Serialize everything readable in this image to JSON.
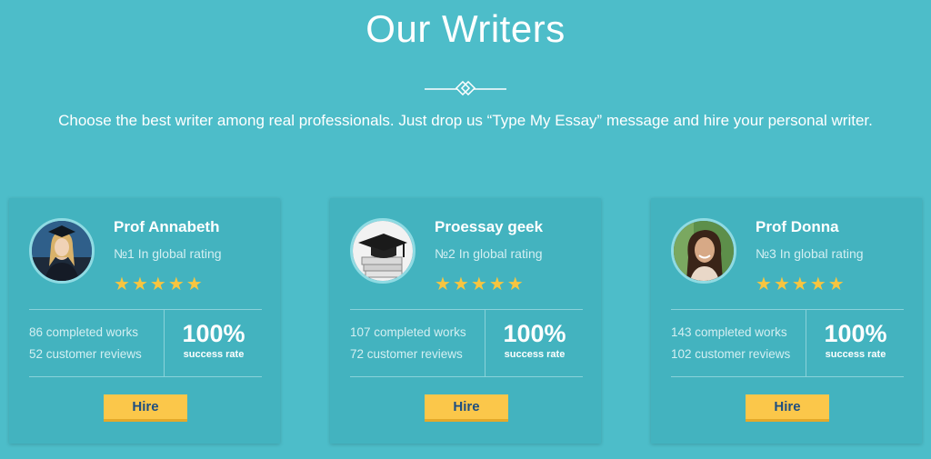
{
  "section": {
    "title": "Our Writers",
    "subtitle": "Choose the best writer among real professionals. Just drop us “Type My Essay” message and hire your personal writer."
  },
  "colors": {
    "background": "#4dbdc9",
    "card": "#43b3bf",
    "star": "#f8c53f",
    "button": "#fbc74a",
    "button_text": "#1f4f80"
  },
  "writers": [
    {
      "name": "Prof Annabeth",
      "rank": "№1 In global rating",
      "rating": 5,
      "works": "86 completed works",
      "reviews": "52 customer reviews",
      "success_pct": "100%",
      "success_label": "success rate",
      "hire_label": "Hire",
      "avatar": "woman-graduate-photo"
    },
    {
      "name": "Proessay geek",
      "rank": "№2 In global rating",
      "rating": 5,
      "works": "107 completed works",
      "reviews": "72 customer reviews",
      "success_pct": "100%",
      "success_label": "success rate",
      "hire_label": "Hire",
      "avatar": "graduation-cap-books-photo"
    },
    {
      "name": "Prof Donna",
      "rank": "№3 In global rating",
      "rating": 5,
      "works": "143 completed works",
      "reviews": "102 customer reviews",
      "success_pct": "100%",
      "success_label": "success rate",
      "hire_label": "Hire",
      "avatar": "woman-portrait-photo"
    }
  ]
}
